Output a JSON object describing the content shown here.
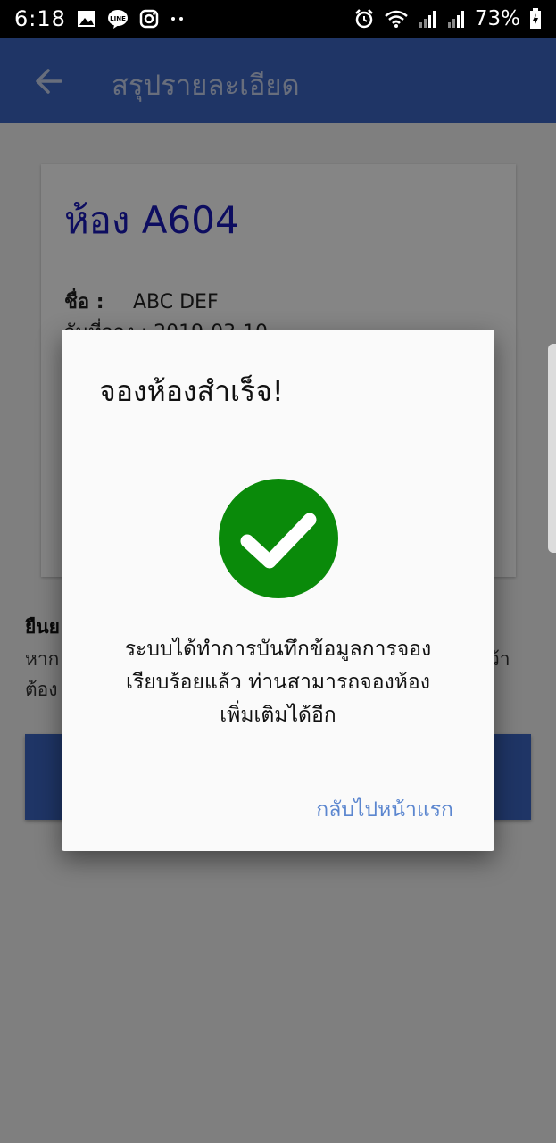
{
  "status_bar": {
    "time": "6:18",
    "battery": "73%",
    "icons": [
      "image-icon",
      "line-icon",
      "instagram-icon",
      "more-dots-icon",
      "alarm-icon",
      "wifi-icon",
      "signal-icon",
      "signal-icon",
      "battery-charging-icon"
    ]
  },
  "app_bar": {
    "title": "สรุปรายละเอียด"
  },
  "summary": {
    "room_title": "ห้อง A604",
    "name_label": "ชื่อ :",
    "name_value": "ABC DEF",
    "date_partial": "วันที่จอง : 2019-03-10"
  },
  "confirm": {
    "title_partial": "ยืนย",
    "line1_partial": "หาก",
    "line2_partial": "ต้อง",
    "line1_right": "ว้า"
  },
  "dialog": {
    "title": "จองห้องสำเร็จ!",
    "icon": "check-circle-icon",
    "message_line1": "ระบบได้ทำการบันทึกข้อมูลการจอง",
    "message_line2": "เรียบร้อยแล้ว ท่านสามารถจองห้อง",
    "message_line3": "เพิ่มเติมได้อีก",
    "action_label": "กลับไปหน้าแรก"
  },
  "colors": {
    "app_bar": "#3d67c4",
    "room_title": "#1a1ab8",
    "success": "#0a8a0a",
    "action_text": "#5b86cf"
  }
}
